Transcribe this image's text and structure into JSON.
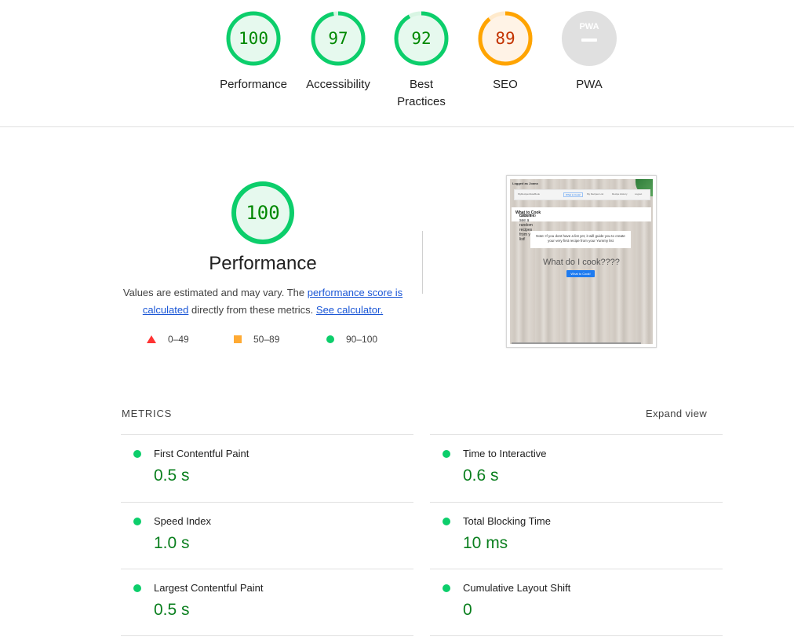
{
  "gauges": [
    {
      "score": "100",
      "label": "Performance",
      "status": "pass"
    },
    {
      "score": "97",
      "label": "Accessibility",
      "status": "pass"
    },
    {
      "score": "92",
      "label": "Best Practices",
      "status": "pass"
    },
    {
      "score": "89",
      "label": "SEO",
      "status": "average"
    },
    {
      "score": "",
      "label": "PWA",
      "status": "na",
      "badge": "PWA"
    }
  ],
  "performance": {
    "score": "100",
    "title": "Performance",
    "desc_prefix": "Values are estimated and may vary. The ",
    "score_link": "performance score is calculated",
    "desc_middle": " directly from these metrics. ",
    "calc_link": "See calculator.",
    "legend": [
      {
        "range": "0–49",
        "shape": "triangle",
        "color": "#ff3333"
      },
      {
        "range": "50–89",
        "shape": "square",
        "color": "#ffaa33"
      },
      {
        "range": "90–100",
        "shape": "circle",
        "color": "#0cce6b"
      }
    ]
  },
  "screenshot": {
    "login_text": "Logged as Joana",
    "nav_items": [
      "MyRecipesNoteBook",
      "What to Cook!",
      "My Recipes List",
      "Recipe History",
      "Logout"
    ],
    "card1_prefix": "Click the ",
    "card1_bold": "What to Cook",
    "card1_suffix": " buttom to see a random recipes from you list!",
    "card2": "Note: If you dont have a list yet, it will guide you to create your very first recipe from your Yummy list",
    "heading": "What do I cook????",
    "button": "What to Cook!"
  },
  "metrics": {
    "header": "METRICS",
    "expand_label": "Expand view",
    "items": [
      {
        "title": "First Contentful Paint",
        "value": "0.5 s"
      },
      {
        "title": "Time to Interactive",
        "value": "0.6 s"
      },
      {
        "title": "Speed Index",
        "value": "1.0 s"
      },
      {
        "title": "Total Blocking Time",
        "value": "10 ms"
      },
      {
        "title": "Largest Contentful Paint",
        "value": "0.5 s"
      },
      {
        "title": "Cumulative Layout Shift",
        "value": "0"
      }
    ]
  },
  "colors": {
    "pass": "#0cce6b",
    "pass_text": "#008800",
    "pass_fill": "#e6f9ee",
    "average": "#ffa400",
    "average_text": "#c33300",
    "average_fill": "#fff3e6",
    "na_fill": "#e0e0e0"
  }
}
